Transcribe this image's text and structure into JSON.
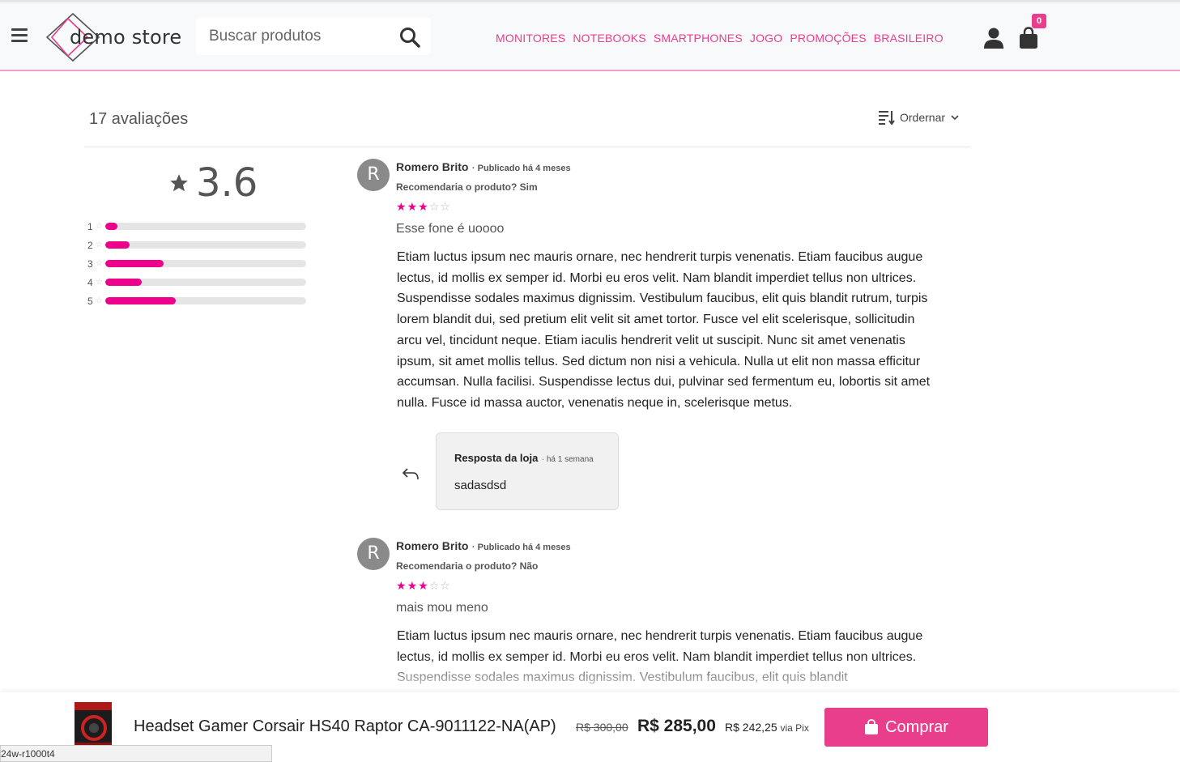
{
  "header": {
    "logo_text": "demo store",
    "search_placeholder": "Buscar produtos",
    "nav": [
      "MONITORES",
      "NOTEBOOKS",
      "SMARTPHONES",
      "JOGO",
      "PROMOÇÕES",
      "BRASILEIRO"
    ],
    "cart_count": "0",
    "accent_color": "#e83e8c"
  },
  "reviews_summary": {
    "count_label": "17 avaliações",
    "sort_label": "Ordernar",
    "average": "3.6",
    "distribution": [
      {
        "label": "1",
        "fraction": 0.06
      },
      {
        "label": "2",
        "fraction": 0.12
      },
      {
        "label": "3",
        "fraction": 0.29
      },
      {
        "label": "4",
        "fraction": 0.18
      },
      {
        "label": "5",
        "fraction": 0.35
      }
    ]
  },
  "reviews": [
    {
      "avatar_letter": "R",
      "author": "Romero Brito",
      "date": "· Publicado há 4 meses",
      "recommend": "Recomendaria o produto? Sim",
      "rating": 3,
      "title": "Esse fone é uoooo",
      "body": "Etiam luctus ipsum nec mauris ornare, nec hendrerit turpis venenatis. Etiam faucibus augue lectus, id mollis ex semper id. Morbi eu eros velit. Nam blandit imperdiet tellus non ultrices. Suspendisse sodales maximus dignissim. Vestibulum faucibus, elit quis blandit rutrum, turpis lorem blandit dui, sed pretium elit velit sit amet tortor. Fusce vel elit scelerisque, sollicitudin arcu vel, tincidunt neque. Etiam iaculis hendrerit velit ut suscipit. Nunc sit amet venenatis ipsum, sit amet mollis tellus. Sed dictum non nisi a vehicula. Nulla ut elit non massa efficitur accumsan. Nulla facilisi. Suspendisse lectus dui, pulvinar sed fermentum eu, lobortis sit amet nulla. Fusce id massa auctor, venenatis neque in, scelerisque metus.",
      "reply": {
        "author": "Resposta da loja",
        "date": "· há 1 semana",
        "text": "sadasdsd"
      }
    },
    {
      "avatar_letter": "R",
      "author": "Romero Brito",
      "date": "· Publicado há 4 meses",
      "recommend": "Recomendaria o produto? Não",
      "rating": 3,
      "title": "mais mou meno",
      "body": "Etiam luctus ipsum nec mauris ornare, nec hendrerit turpis venenatis. Etiam faucibus augue lectus, id mollis ex semper id. Morbi eu eros velit. Nam blandit imperdiet tellus non ultrices. Suspendisse sodales maximus dignissim. Vestibulum faucibus, elit quis blandit"
    }
  ],
  "product_bar": {
    "name": "Headset Gamer Corsair HS40 Raptor CA-9011122-NA(AP)",
    "old_price": "R$ 300,00",
    "price": "R$ 285,00",
    "pix_price": "R$ 242,25",
    "pix_via": "via Pix",
    "buy_label": "Comprar"
  },
  "status_url": "24w-r1000t4"
}
